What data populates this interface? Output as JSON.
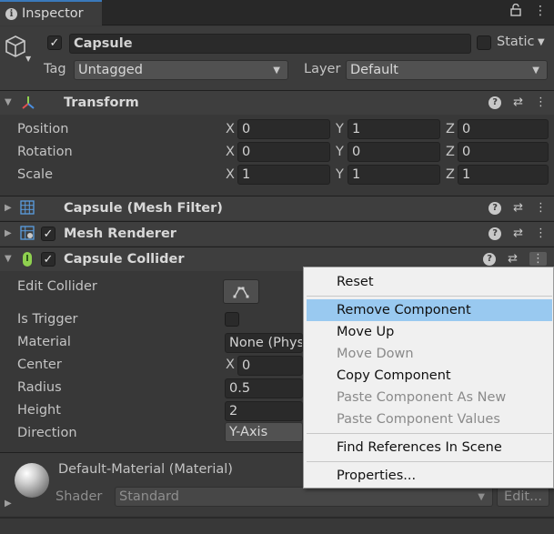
{
  "window": {
    "tab_label": "Inspector",
    "lock_icon": "lock-icon",
    "more_icon": "kebab-menu-icon"
  },
  "object": {
    "name": "Capsule",
    "active": true,
    "static_label": "Static",
    "tag_label": "Tag",
    "tag_value": "Untagged",
    "layer_label": "Layer",
    "layer_value": "Default"
  },
  "transform": {
    "title": "Transform",
    "rows": [
      {
        "label": "Position",
        "x": "0",
        "y": "1",
        "z": "0"
      },
      {
        "label": "Rotation",
        "x": "0",
        "y": "0",
        "z": "0"
      },
      {
        "label": "Scale",
        "x": "1",
        "y": "1",
        "z": "1"
      }
    ],
    "axis_x": "X",
    "axis_y": "Y",
    "axis_z": "Z"
  },
  "components": {
    "mesh_filter": "Capsule (Mesh Filter)",
    "mesh_renderer": "Mesh Renderer",
    "capsule_collider": "Capsule Collider"
  },
  "collider": {
    "edit_collider": "Edit Collider",
    "is_trigger": "Is Trigger",
    "material": "Material",
    "material_value": "None (Phys",
    "center": "Center",
    "center_x": "0",
    "radius": "Radius",
    "radius_value": "0.5",
    "height": "Height",
    "height_value": "2",
    "direction": "Direction",
    "direction_value": "Y-Axis"
  },
  "material": {
    "name": "Default-Material (Material)",
    "shader_label": "Shader",
    "shader_value": "Standard",
    "edit_label": "Edit..."
  },
  "context_menu": {
    "items": [
      {
        "label": "Reset",
        "enabled": true
      },
      {
        "label": "Remove Component",
        "enabled": true,
        "highlighted": true
      },
      {
        "label": "Move Up",
        "enabled": true
      },
      {
        "label": "Move Down",
        "enabled": false
      },
      {
        "label": "Copy Component",
        "enabled": true
      },
      {
        "label": "Paste Component As New",
        "enabled": false
      },
      {
        "label": "Paste Component Values",
        "enabled": false
      },
      {
        "label": "Find References In Scene",
        "enabled": true
      },
      {
        "label": "Properties...",
        "enabled": true
      }
    ]
  },
  "colors": {
    "accent_tab": "#3a79bb",
    "menu_highlight": "#99c9f0",
    "panel_bg": "#383838"
  }
}
